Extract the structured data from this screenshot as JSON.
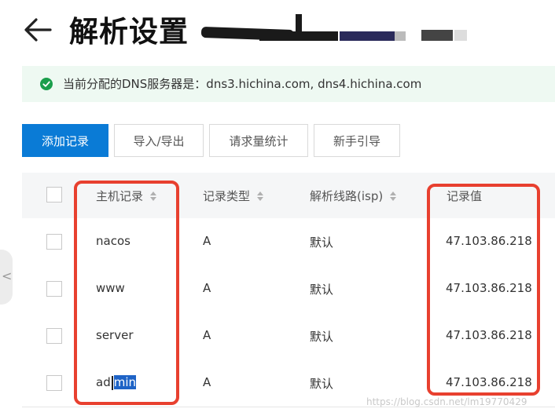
{
  "header": {
    "title": "解析设置"
  },
  "notice": {
    "text": "当前分配的DNS服务器是：dns3.hichina.com, dns4.hichina.com"
  },
  "toolbar": {
    "add_label": "添加记录",
    "import_export_label": "导入/导出",
    "stats_label": "请求量统计",
    "guide_label": "新手引导"
  },
  "table": {
    "columns": [
      "主机记录",
      "记录类型",
      "解析线路(isp)",
      "记录值"
    ],
    "rows": [
      {
        "host": "nacos",
        "type": "A",
        "line": "默认",
        "value": "47.103.86.218"
      },
      {
        "host": "www",
        "type": "A",
        "line": "默认",
        "value": "47.103.86.218"
      },
      {
        "host": "server",
        "type": "A",
        "line": "默认",
        "value": "47.103.86.218"
      },
      {
        "host_prefix": "ad",
        "host_selected": "min",
        "type": "A",
        "line": "默认",
        "value": "47.103.86.218"
      }
    ]
  },
  "side": {
    "arrow": "<"
  },
  "watermark": "https://blog.csdn.net/lm19770429",
  "colors": {
    "primary": "#0a7bd6",
    "highlight": "#e8402f",
    "success": "#1a9e4b"
  }
}
